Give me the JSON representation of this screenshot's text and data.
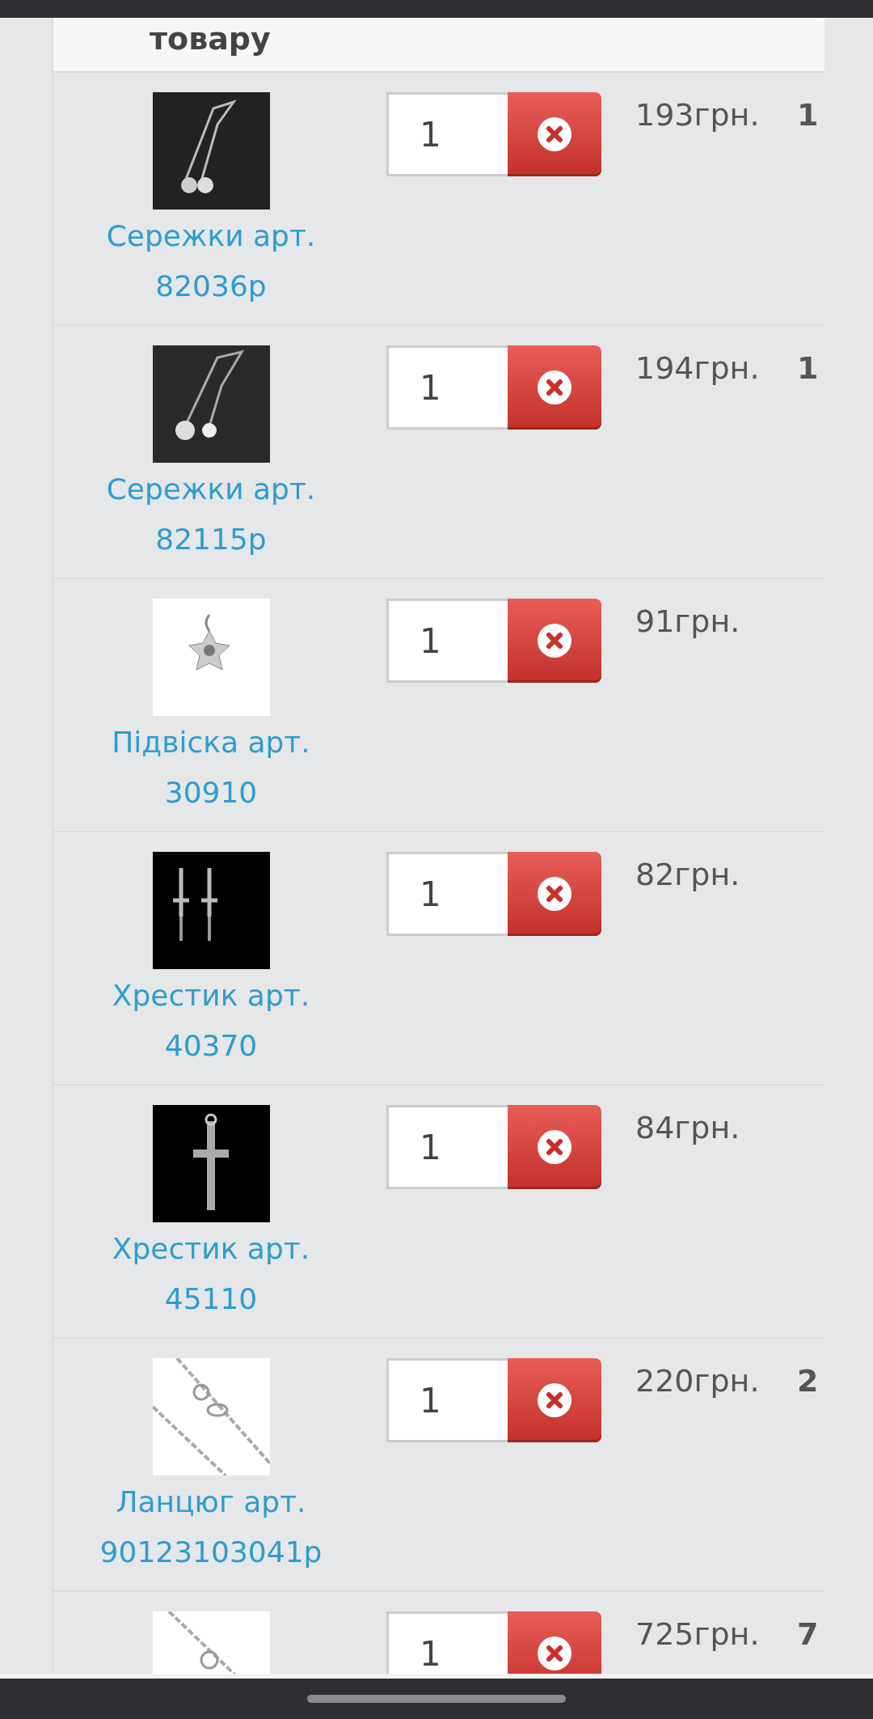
{
  "table": {
    "header": {
      "column_1": "товару"
    },
    "rows": [
      {
        "name": "Сережки арт. 82036р",
        "quantity": "1",
        "price": "193грн.",
        "total": "1"
      },
      {
        "name": "Сережки арт. 82115р",
        "quantity": "1",
        "price": "194грн.",
        "total": "1"
      },
      {
        "name": "Підвіска арт. 30910",
        "quantity": "1",
        "price": "91грн."
      },
      {
        "name": "Хрестик арт. 40370",
        "quantity": "1",
        "price": "82грн."
      },
      {
        "name": "Хрестик арт. 45110",
        "quantity": "1",
        "price": "84грн."
      },
      {
        "name": "Ланцюг арт. 90123103041р",
        "quantity": "1",
        "price": "220грн.",
        "total": "2"
      },
      {
        "name": "",
        "quantity": "1",
        "price": "725грн.",
        "total": "7"
      }
    ]
  }
}
